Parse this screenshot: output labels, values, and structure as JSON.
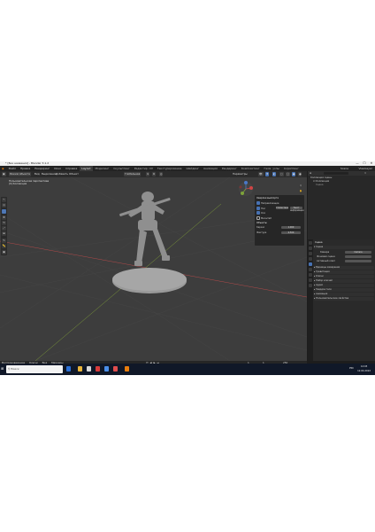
{
  "window": {
    "title": "* [Без названия] - Blender 3.1.2",
    "controls": [
      "—",
      "☐",
      "✕"
    ]
  },
  "menubar": {
    "menus": [
      "Файл",
      "Правка",
      "Рендеринг",
      "Окно",
      "Справка"
    ],
    "workspaces": [
      "Layout",
      "Моделинг",
      "Скульптинг",
      "Редактир. UV",
      "Текстурирование",
      "Шейдинг",
      "Анимация",
      "Рендеринг",
      "Композитинг",
      "Геом. узлы",
      "Скриптинг"
    ],
    "active_workspace": "Layout",
    "scene": "Scene",
    "view_layer": "ViewLayer"
  },
  "viewport_header": {
    "mode": "Режим объекта",
    "menus": [
      "Вид",
      "Выделение",
      "Добавить",
      "Объект"
    ],
    "transform_orientation": "Глобальная",
    "options_label": "Параметры"
  },
  "viewport": {
    "view_name": "Пользовательская перспектива",
    "collection": "(0) Коллекция",
    "bg_color": "#3d3d3d",
    "grid_color": "#4a4a4a",
    "x_axis_color": "#b34a4a",
    "y_axis_color": "#7d9a3a",
    "model_color": "#9a9a9a"
  },
  "overlays": {
    "title": "Оверлеи вьюпорта",
    "items": [
      {
        "label": "Направляющие",
        "checked": true
      },
      {
        "label": "Пол",
        "checked": true
      },
      {
        "label": "Оси",
        "checked": true
      },
      {
        "label": "Масштаб",
        "checked": false
      }
    ],
    "fields": [
      "Статистика",
      "Текст информации"
    ],
    "sections": [
      "Объекты",
      "Каркас",
      "Фактура"
    ],
    "values": [
      "1.000",
      "0.500"
    ]
  },
  "timeline": {
    "menus": [
      "Воспроизведение",
      "Ключи",
      "Вид",
      "Маркеры"
    ],
    "current_frame": "1",
    "start": "1",
    "end": "250",
    "ruler": [
      "0",
      "10",
      "20",
      "30",
      "40",
      "50",
      "60",
      "70",
      "80",
      "90",
      "100",
      "110",
      "120",
      "130",
      "140",
      "150",
      "160",
      "170",
      "180",
      "190",
      "200",
      "210",
      "220",
      "230",
      "240",
      "250"
    ]
  },
  "outliner": {
    "title": "Коллекция сцены",
    "items": [
      "Коллекция",
      "Сцена"
    ]
  },
  "properties": {
    "tab_header": "Сцена",
    "sections": [
      "Сцена",
      "Единицы измерения",
      "Гравитация",
      "Ключи",
      "Набор ключей",
      "Аудио",
      "Твердое тело",
      "Анимация",
      "Пользовательские свойства"
    ],
    "rows": [
      {
        "label": "Камера",
        "value": "Camera"
      },
      {
        "label": "Фоновая сцена",
        "value": ""
      },
      {
        "label": "Активный клип",
        "value": ""
      }
    ]
  },
  "taskbar": {
    "search_placeholder": "Поиск",
    "time": "12:03",
    "date": "12.04.2022",
    "lang": "РУС"
  }
}
